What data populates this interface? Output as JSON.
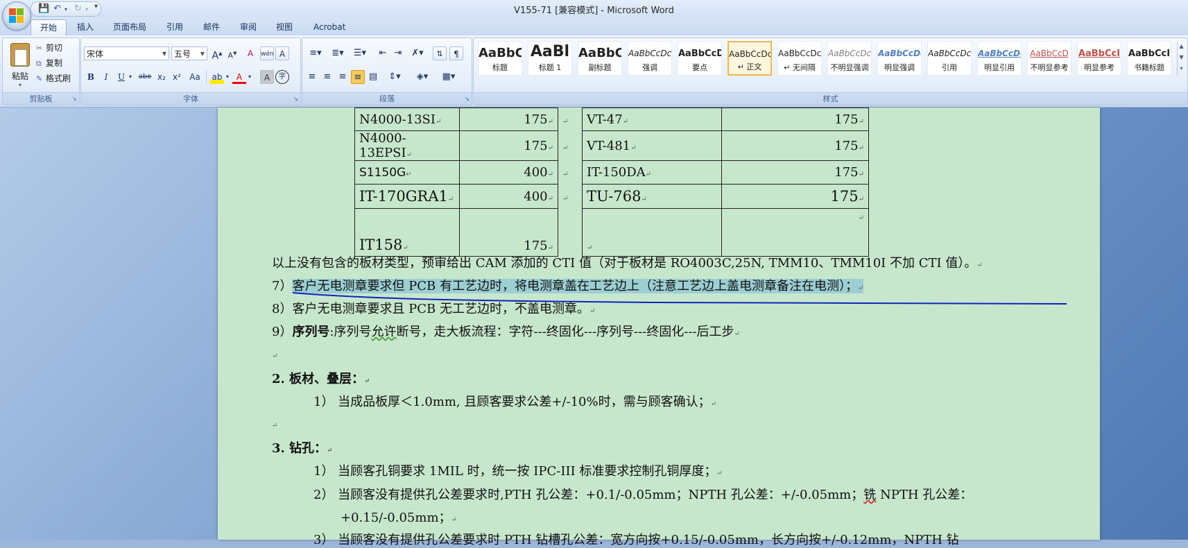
{
  "window": {
    "title": "V155-71 [兼容模式] - Microsoft Word"
  },
  "quick_access": {
    "save_icon": "save-icon",
    "undo_icon": "undo-icon",
    "redo_icon": "redo-icon",
    "more": "▾"
  },
  "tabs": [
    "开始",
    "插入",
    "页面布局",
    "引用",
    "邮件",
    "审阅",
    "视图",
    "Acrobat"
  ],
  "ribbon": {
    "clipboard": {
      "paste": "粘贴",
      "cut": "剪切",
      "copy": "复制",
      "format_painter": "格式刷",
      "group_label": "剪贴板"
    },
    "font": {
      "font_name": "宋体",
      "font_size": "五号",
      "grow": "A",
      "shrink": "A",
      "clear": "A",
      "wen": "wén",
      "bian": "变",
      "border_a": "A",
      "bold": "B",
      "italic": "I",
      "underline": "U",
      "strike": "abe",
      "sub": "x₂",
      "sup": "x²",
      "case": "Aa",
      "highlight": "ab",
      "color": "A",
      "shade": "A",
      "enclose": "字",
      "group_label": "字体"
    },
    "paragraph": {
      "group_label": "段落"
    },
    "styles": {
      "group_label": "样式",
      "items": [
        {
          "sample": "AaBbC",
          "name": "标题"
        },
        {
          "sample": "AaBl",
          "name": "标题 1"
        },
        {
          "sample": "AaBbC",
          "name": "副标题"
        },
        {
          "sample": "AaBbCcDc",
          "name": "强调"
        },
        {
          "sample": "AaBbCcD",
          "name": "要点"
        },
        {
          "sample": "AaBbCcDc",
          "name": "↵ 正文"
        },
        {
          "sample": "AaBbCcDc",
          "name": "↵ 无间隔"
        },
        {
          "sample": "AaBbCcDc",
          "name": "不明显强调"
        },
        {
          "sample": "AaBbCcDc",
          "name": "明显强调"
        },
        {
          "sample": "AaBbCcDc",
          "name": "引用"
        },
        {
          "sample": "AaBbCcDc",
          "name": "明显引用"
        },
        {
          "sample": "AaBbCcD",
          "name": "不明显参考"
        },
        {
          "sample": "AaBbCcI",
          "name": "明显参考"
        },
        {
          "sample": "AaBbCcI",
          "name": "书籍标题"
        }
      ]
    }
  },
  "document": {
    "table": {
      "rows": [
        {
          "a": "N4000-13SI",
          "av": "175",
          "b": "VT-47",
          "bv": "175"
        },
        {
          "a": "N4000-13EPSI",
          "av": "175",
          "b": "VT-481",
          "bv": "175"
        },
        {
          "a": "S1150G",
          "av": "400",
          "b": "IT-150DA",
          "bv": "175"
        },
        {
          "a": "IT-170GRA1",
          "av": "400",
          "b": "TU-768",
          "bv": "175"
        },
        {
          "a": "IT158",
          "av": "175",
          "b": "",
          "bv": ""
        }
      ]
    },
    "lines": {
      "l1": "以上没有包含的板材类型，预审给出 CAM 添加的 CTI 值（对于板材是 RO4003C,25N, TMM10、TMM10I 不加 CTI 值）。",
      "l2_num": "7）",
      "l2_text": "客户无电测章要求但 PCB 有工艺边时，将电测章盖在工艺边上（注意工艺边上盖电测章备注在电测）；",
      "l3": "8）客户无电测章要求且 PCB 无工艺边时，不盖电测章。",
      "l4_pre": "9）",
      "l4_bold": "序列号",
      "l4_mid": ":序列号",
      "l4_squig": "允许",
      "l4_rest": "断号，走大板流程：字符---终固化---序列号---终固化---后工步",
      "h2": "2.   板材、叠层：",
      "h2_1": "1） 当成品板厚＜1.0mm, 且顾客要求公差+/-10%时，需与顾客确认；",
      "h3": "3.   钻孔：",
      "h3_1": "1） 当顾客孔铜要求 1MIL 时，统一按 IPC-III 标准要求控制孔铜厚度；",
      "h3_2a": "2） 当顾客没有提供孔公差要求时,PTH 孔公差：+0.1/-0.05mm；NPTH 孔公差：+/-0.05mm；",
      "h3_2b": "铣",
      "h3_2c": " NPTH 孔公差：",
      "h3_2d": "+0.15/-0.05mm；",
      "h3_3": "3） 当顾客没有提供孔公差要求时 PTH 钻槽孔公差：宽方向按+0.15/-0.05mm，长方向按+/-0.12mm，NPTH 钻"
    },
    "pilcrow": "↵"
  }
}
